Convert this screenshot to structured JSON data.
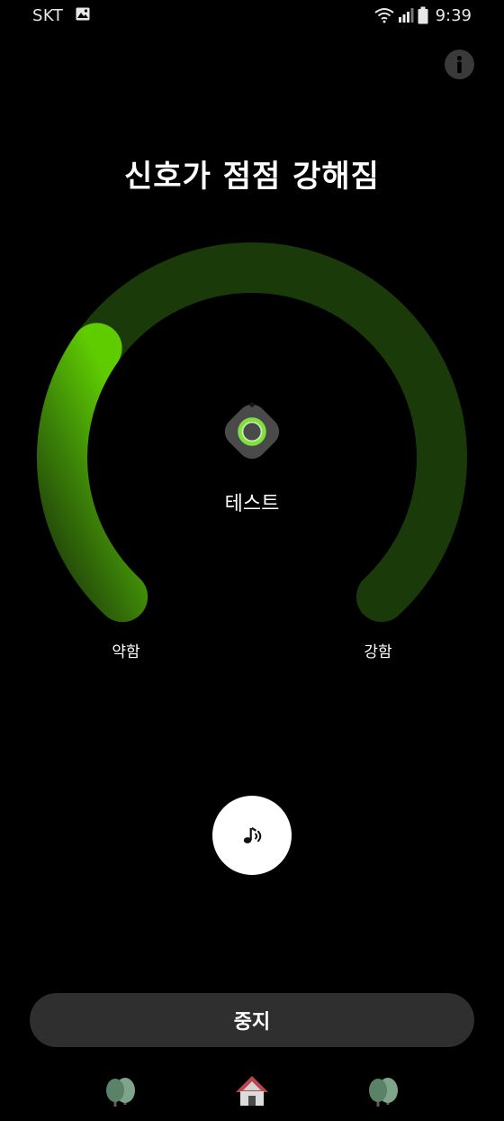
{
  "status_bar": {
    "carrier": "SKT",
    "time": "9:39",
    "icons": [
      "gallery-icon",
      "wifi-icon",
      "signal-icon",
      "battery-icon"
    ]
  },
  "header": {
    "info_icon": "info-icon"
  },
  "main": {
    "title": "신호가 점점 강해짐",
    "device_name": "테스트",
    "device_icon": "smart-tag-icon",
    "gauge": {
      "signal_level": 0.3,
      "label_weak": "약함",
      "label_strong": "강함",
      "track_color": "#1a3a0a",
      "fill_color": "#5fc800"
    },
    "sound_button_icon": "ring-sound-icon",
    "stop_label": "중지"
  },
  "colors": {
    "background": "#000000",
    "button_bg": "#2f2f2f",
    "accent": "#5fc800"
  },
  "bottom_icons": [
    "tree-icon",
    "house-icon",
    "tree-icon"
  ]
}
